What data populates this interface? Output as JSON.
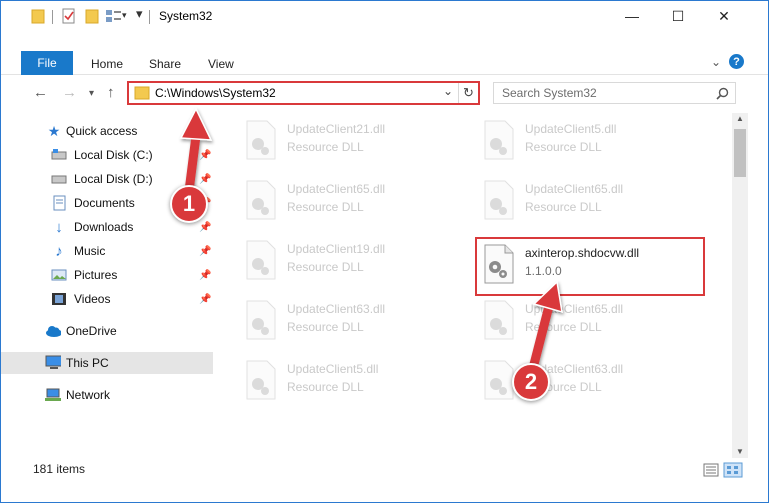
{
  "window": {
    "title": "System32",
    "controls": {
      "minimize": "—",
      "maximize": "☐",
      "close": "✕"
    }
  },
  "ribbon": {
    "file": "File",
    "tabs": [
      "Home",
      "Share",
      "View"
    ],
    "help": "?"
  },
  "address": {
    "path": "C:\\Windows\\System32",
    "search_placeholder": "Search System32"
  },
  "sidebar": {
    "items": [
      {
        "label": "Quick access",
        "icon": "star-icon"
      },
      {
        "label": "Local Disk (C:)",
        "icon": "drive-icon",
        "pinned": true
      },
      {
        "label": "Local Disk (D:)",
        "icon": "drive-icon",
        "pinned": true
      },
      {
        "label": "Documents",
        "icon": "documents-icon",
        "pinned": true
      },
      {
        "label": "Downloads",
        "icon": "download-icon",
        "pinned": true
      },
      {
        "label": "Music",
        "icon": "music-icon",
        "pinned": true
      },
      {
        "label": "Pictures",
        "icon": "pictures-icon",
        "pinned": true
      },
      {
        "label": "Videos",
        "icon": "videos-icon",
        "pinned": true
      },
      {
        "label": "OneDrive",
        "icon": "cloud-icon"
      },
      {
        "label": "This PC",
        "icon": "computer-icon"
      },
      {
        "label": "Network",
        "icon": "network-icon"
      }
    ]
  },
  "files": [
    {
      "name": "UpdateClient21.dll",
      "type": "Resource DLL"
    },
    {
      "name": "UpdateClient5.dll",
      "type": "Resource DLL"
    },
    {
      "name": "UpdateClient65.dll",
      "type": "Resource DLL"
    },
    {
      "name": "UpdateClient65.dll",
      "type": "Resource DLL"
    },
    {
      "name": "UpdateClient19.dll",
      "type": "Resource DLL"
    },
    {
      "name": "axinterop.shdocvw.dll",
      "type": "1.1.0.0"
    },
    {
      "name": "UpdateClient63.dll",
      "type": "Resource DLL"
    },
    {
      "name": "UpdateClient65.dll",
      "type": "Resource DLL"
    },
    {
      "name": "UpdateClient5.dll",
      "type": "Resource DLL"
    },
    {
      "name": "UpdateClient63.dll",
      "type": "Resource DLL"
    }
  ],
  "status": {
    "count": "181 items"
  },
  "annotations": {
    "step1": "1",
    "step2": "2"
  },
  "colors": {
    "accent": "#1979ca",
    "annotation": "#d9393b"
  }
}
